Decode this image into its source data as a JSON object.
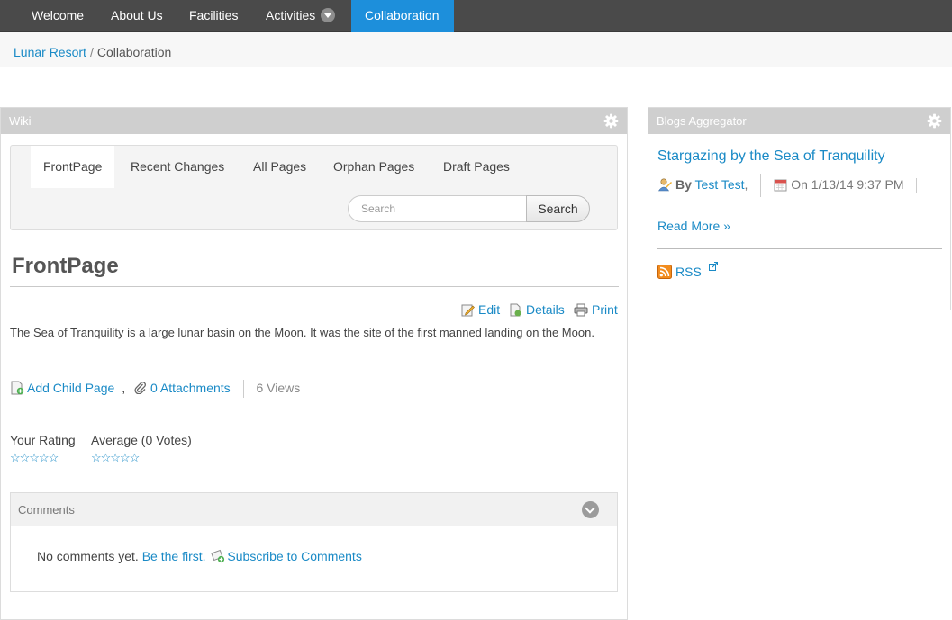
{
  "nav": {
    "items": [
      {
        "label": "Welcome"
      },
      {
        "label": "About Us"
      },
      {
        "label": "Facilities"
      },
      {
        "label": "Activities"
      },
      {
        "label": "Collaboration"
      }
    ],
    "active": "Collaboration"
  },
  "breadcrumb": {
    "root": "Lunar Resort",
    "separator": "/",
    "current": "Collaboration"
  },
  "wiki": {
    "portlet_title": "Wiki",
    "tabs": [
      {
        "label": "FrontPage"
      },
      {
        "label": "Recent Changes"
      },
      {
        "label": "All Pages"
      },
      {
        "label": "Orphan Pages"
      },
      {
        "label": "Draft Pages"
      }
    ],
    "active_tab": "FrontPage",
    "search": {
      "placeholder": "Search",
      "value": "",
      "button": "Search"
    },
    "page": {
      "title": "FrontPage",
      "actions": {
        "edit": "Edit",
        "details": "Details",
        "print": "Print"
      },
      "content": "The Sea of Tranquility is a large lunar basin on the Moon. It was the site of the first manned landing on the Moon.",
      "add_child": "Add Child Page",
      "comma": ",",
      "attachments": "0 Attachments",
      "views": "6 Views"
    },
    "rating": {
      "your_label": "Your Rating",
      "average_label": "Average (0 Votes)",
      "your_value": 0,
      "average_value": 0,
      "max": 5,
      "stars_glyphs": "☆☆☆☆☆"
    },
    "comments": {
      "title": "Comments",
      "empty_text": "No comments yet.",
      "be_first": "Be the first.",
      "subscribe": "Subscribe to Comments"
    }
  },
  "blogs": {
    "portlet_title": "Blogs Aggregator",
    "entry": {
      "title": "Stargazing by the Sea of Tranquility",
      "by_label": "By",
      "author": "Test Test",
      "comma": ",",
      "date": "On 1/13/14 9:37 PM"
    },
    "read_more": "Read More »",
    "rss": "RSS"
  },
  "colors": {
    "accent": "#1a8ac6",
    "nav_bg": "#4a4a4a",
    "nav_active": "#1d8fdb",
    "portlet_header": "#cfcfcf"
  }
}
